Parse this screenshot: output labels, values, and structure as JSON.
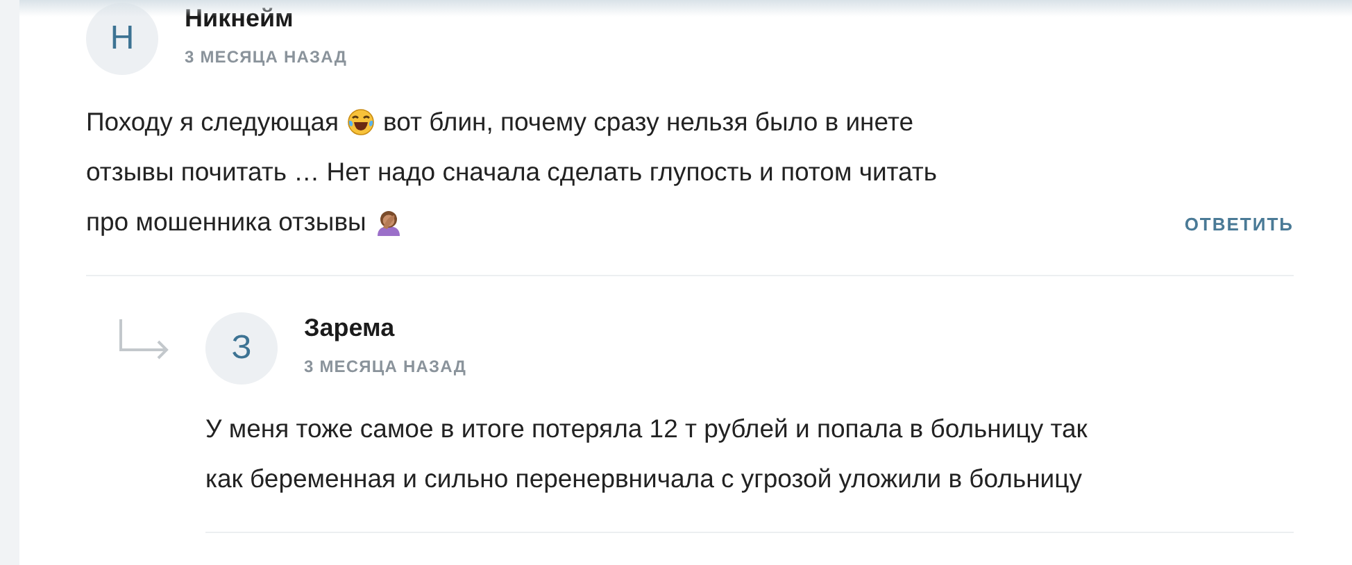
{
  "comments": [
    {
      "avatar_letter": "Н",
      "author": "Никнейм",
      "time": "3 МЕСЯЦА НАЗАД",
      "lines": [
        [
          {
            "kind": "text",
            "value": "Походу я следующая"
          },
          {
            "kind": "laughing_emoji"
          },
          {
            "kind": "text",
            "value": "вот блин, почему сразу нельзя было в инете"
          }
        ],
        [
          {
            "kind": "text",
            "value": "отзывы почитать … Нет надо сначала сделать глупость и потом читать"
          }
        ],
        [
          {
            "kind": "text",
            "value": "про мошенника отзывы"
          },
          {
            "kind": "facepalm_emoji"
          }
        ]
      ],
      "reply_button": "ОТВЕТИТЬ",
      "children": [
        {
          "avatar_letter": "З",
          "author": "Зарема",
          "time": "3 МЕСЯЦА НАЗАД",
          "lines": [
            [
              {
                "kind": "text",
                "value": "У меня тоже самое в итоге потеряла 12 т рублей и попала в больницу так"
              }
            ],
            [
              {
                "kind": "text",
                "value": "как беременная и сильно перенервничала с угрозой уложили в больницу"
              }
            ]
          ]
        }
      ]
    }
  ]
}
